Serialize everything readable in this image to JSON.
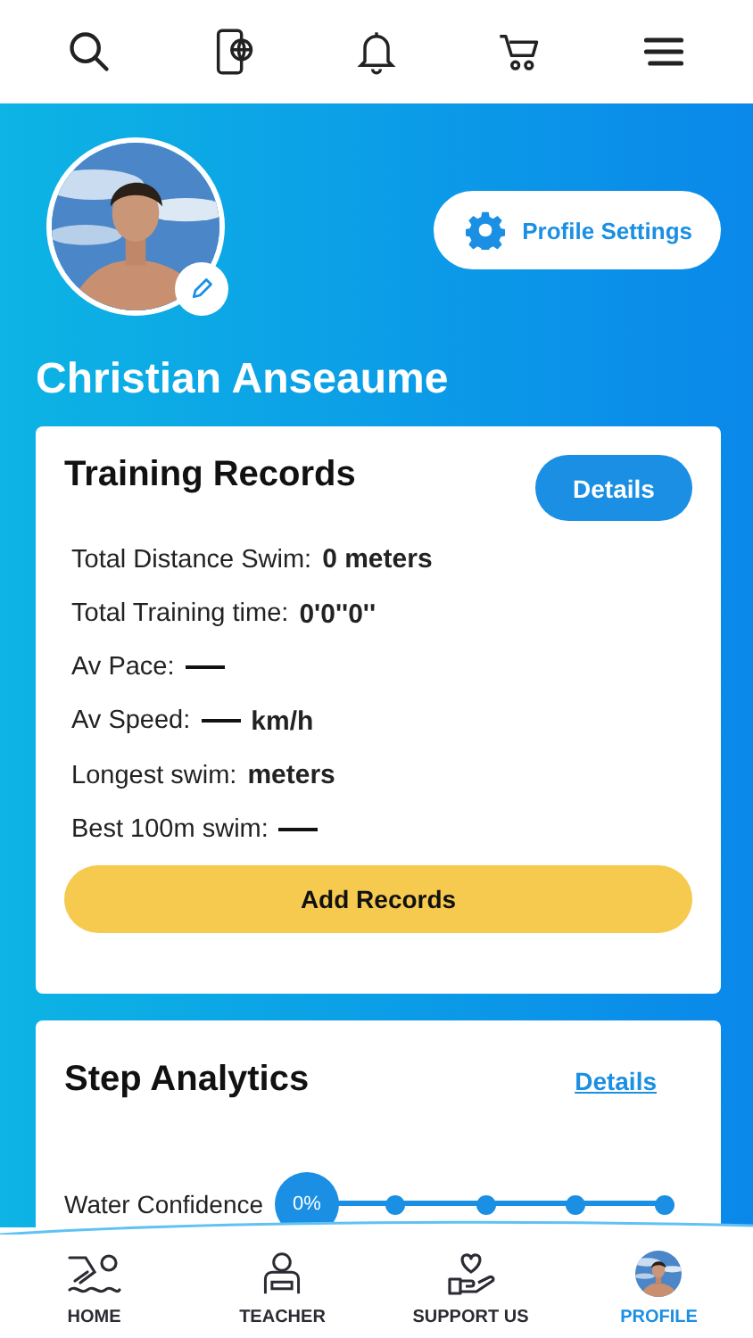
{
  "top_bar": {
    "icons": [
      {
        "kind": "search"
      },
      {
        "kind": "phone-globe"
      },
      {
        "kind": "bell"
      },
      {
        "kind": "cart"
      },
      {
        "kind": "menu"
      }
    ]
  },
  "profile": {
    "name": "Christian Anseaume",
    "settings_button": "Profile Settings"
  },
  "training_records": {
    "title": "Training Records",
    "details_button": "Details",
    "rows": [
      {
        "label": "Total Distance Swim:",
        "missing": false,
        "value": "0 meters"
      },
      {
        "label": "Total Training time:",
        "missing": false,
        "value": "0'0''0''"
      },
      {
        "label": "Av Pace:",
        "missing": true
      },
      {
        "label": "Av Speed:",
        "missing": true,
        "value": "km/h"
      },
      {
        "label": "Longest swim:",
        "missing": false,
        "value": "meters"
      },
      {
        "label": "Best 100m swim:",
        "missing": true
      }
    ],
    "add_button": "Add Records"
  },
  "step_analytics": {
    "title": "Step Analytics",
    "details_link": "Details",
    "steps": [
      {
        "label": "Water Confidence",
        "percent": "0%",
        "level": 0
      }
    ]
  },
  "nav": [
    {
      "kind": "swimmer",
      "label": "HOME",
      "selected": false
    },
    {
      "kind": "teacher",
      "label": "TEACHER",
      "selected": false
    },
    {
      "kind": "heart-hand",
      "label": "SUPPORT US",
      "selected": false
    },
    {
      "kind": "avatar",
      "label": "PROFILE",
      "selected": true
    }
  ]
}
